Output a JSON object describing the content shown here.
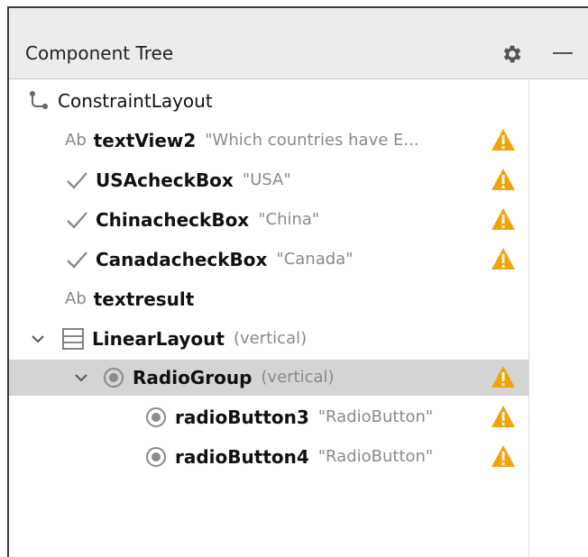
{
  "header": {
    "title": "Component Tree",
    "settings_icon": "gear-icon",
    "minimize_icon": "minimize-icon"
  },
  "tree": [
    {
      "name": "ConstraintLayout",
      "icon": "constraint-layout-icon"
    },
    {
      "name": "textView2",
      "text": "\"Which countries have E...",
      "icon": "textview-ab-icon",
      "warning": true
    },
    {
      "name": "USAcheckBox",
      "text": "\"USA\"",
      "icon": "checkbox-icon",
      "warning": true
    },
    {
      "name": "ChinacheckBox",
      "text": "\"China\"",
      "icon": "checkbox-icon",
      "warning": true
    },
    {
      "name": "CanadacheckBox",
      "text": "\"Canada\"",
      "icon": "checkbox-icon",
      "warning": true
    },
    {
      "name": "textresult",
      "icon": "textview-ab-icon"
    },
    {
      "name": "LinearLayout",
      "text": "(vertical)",
      "icon": "linear-layout-icon",
      "expanded": true
    },
    {
      "name": "RadioGroup",
      "text": "(vertical)",
      "icon": "radio-group-icon",
      "expanded": true,
      "selected": true,
      "warning": true
    },
    {
      "name": "radioButton3",
      "text": "\"RadioButton\"",
      "icon": "radio-button-icon",
      "warning": true
    },
    {
      "name": "radioButton4",
      "text": "\"RadioButton\"",
      "icon": "radio-button-icon",
      "warning": true
    }
  ],
  "ab_label": "Ab",
  "colors": {
    "warning": "#f0a30a",
    "selection": "#d4d4d4",
    "header": "#ececec"
  }
}
